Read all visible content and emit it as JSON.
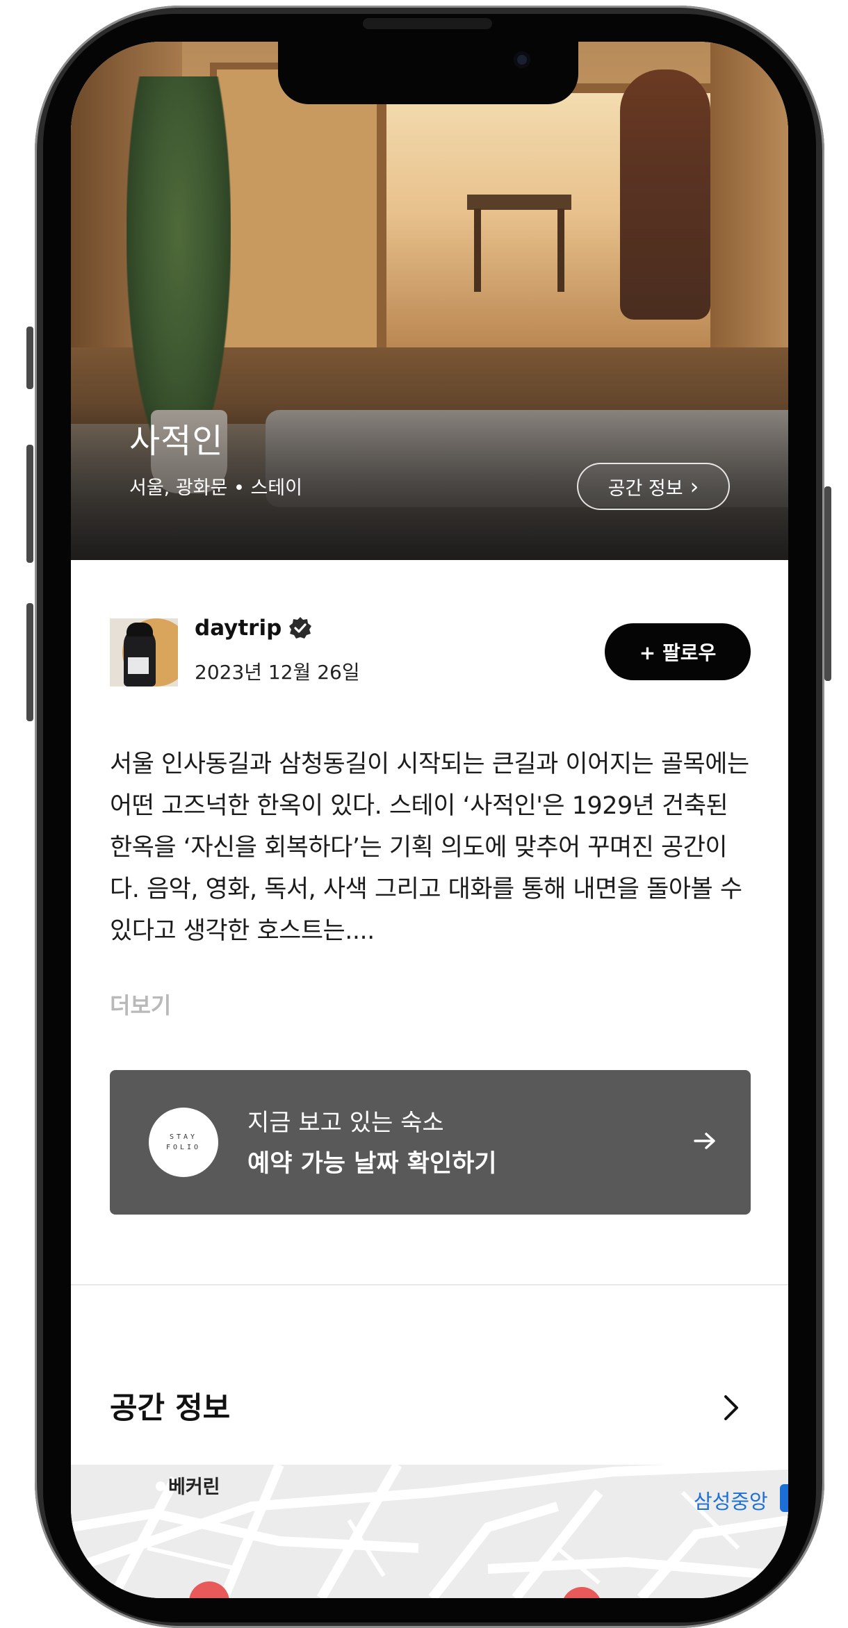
{
  "hero": {
    "title": "사적인",
    "subtitle": "서울, 광화문 • 스테이",
    "space_info_label": "공간 정보",
    "space_info_chevron": "›"
  },
  "author": {
    "name": "daytrip",
    "date": "2023년 12월 26일",
    "follow_label": "+ 팔로우"
  },
  "description": {
    "text": "서울 인사동길과 삼청동길이 시작되는 큰길과 이어지는 골목에는 어떤 고즈넉한 한옥이 있다. 스테이 ‘사적인'은 1929년 건축된 한옥을 ‘자신을 회복하다’는 기획 의도에 맞추어 꾸며진 공간이다. 음악, 영화, 독서, 사색 그리고 대화를 통해 내면을 돌아볼 수 있다고 생각한 호스트는....",
    "more_label": "더보기"
  },
  "booking_card": {
    "logo_line1": "STAY",
    "logo_line2": "FOLIO",
    "line1": "지금 보고 있는 숙소",
    "line2": "예약 가능 날짜 확인하기"
  },
  "section": {
    "title": "공간 정보"
  },
  "map": {
    "label_1": "베커린",
    "label_2": "삼성중앙"
  },
  "icons": {
    "verified": "verified-badge-icon",
    "arrow": "arrow-right-icon",
    "chevron": "chevron-right-icon"
  },
  "colors": {
    "follow_bg": "#050505",
    "card_bg": "#595959",
    "more_text": "#b9b9b9",
    "map_label": "#1c6fd6"
  }
}
